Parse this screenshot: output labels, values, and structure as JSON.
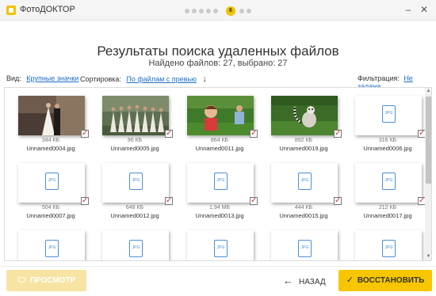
{
  "window": {
    "title": "ФотоДОКТОР",
    "step_number": "6",
    "minimize": "–",
    "close": "✕"
  },
  "header": {
    "title": "Результаты поиска удаленных файлов",
    "summary": "Найдено файлов: 27, выбрано: 27"
  },
  "options": {
    "view_label": "Вид:",
    "view_value": "Крупные значки",
    "sort_label": "Сортировка:",
    "sort_value": "По файлам с превью",
    "sort_arrow": "↓",
    "filter_label": "Фильтрация:",
    "filter_value": "Не задана"
  },
  "files": [
    {
      "name": "Unnamed0004.jpg",
      "size": "344 КБ",
      "preview": "wedding-couple",
      "checked": true
    },
    {
      "name": "Unnamed0005.jpg",
      "size": "96 КБ",
      "preview": "bridesmaids",
      "checked": true
    },
    {
      "name": "Unnamed0011.jpg",
      "size": "864 КБ",
      "preview": "child-on-grass",
      "checked": true
    },
    {
      "name": "Unnamed0019.jpg",
      "size": "892 КБ",
      "preview": "lemur-on-grass",
      "checked": true
    },
    {
      "name": "Unnamed0006.jpg",
      "size": "316 КБ",
      "preview": "jpg-icon",
      "checked": true
    },
    {
      "name": "Unnamed0007.jpg",
      "size": "504 КБ",
      "preview": "jpg-icon",
      "checked": true
    },
    {
      "name": "Unnamed0012.jpg",
      "size": "648 КБ",
      "preview": "jpg-icon",
      "checked": true
    },
    {
      "name": "Unnamed0013.jpg",
      "size": "1,94 МБ",
      "preview": "jpg-icon",
      "checked": true
    },
    {
      "name": "Unnamed0015.jpg",
      "size": "444 КБ",
      "preview": "jpg-icon",
      "checked": true
    },
    {
      "name": "Unnamed0017.jpg",
      "size": "212 КБ",
      "preview": "jpg-icon",
      "checked": true
    },
    {
      "name": "",
      "size": "",
      "preview": "jpg-icon",
      "checked": false
    },
    {
      "name": "",
      "size": "",
      "preview": "jpg-icon",
      "checked": false
    },
    {
      "name": "",
      "size": "",
      "preview": "jpg-icon",
      "checked": false
    },
    {
      "name": "",
      "size": "",
      "preview": "jpg-icon",
      "checked": false
    },
    {
      "name": "",
      "size": "",
      "preview": "jpg-icon",
      "checked": false
    }
  ],
  "footer": {
    "preview_label": "ПРОСМОТР",
    "back_label": "НАЗАД",
    "back_arrow": "←",
    "restore_label": "ВОССТАНОВИТЬ",
    "restore_check": "✓"
  },
  "colors": {
    "accent": "#f7c600",
    "accent_disabled": "#f7e4a3",
    "link": "#1f6fc5",
    "check": "#d0302a",
    "jpg_icon": "#4a90d9"
  }
}
